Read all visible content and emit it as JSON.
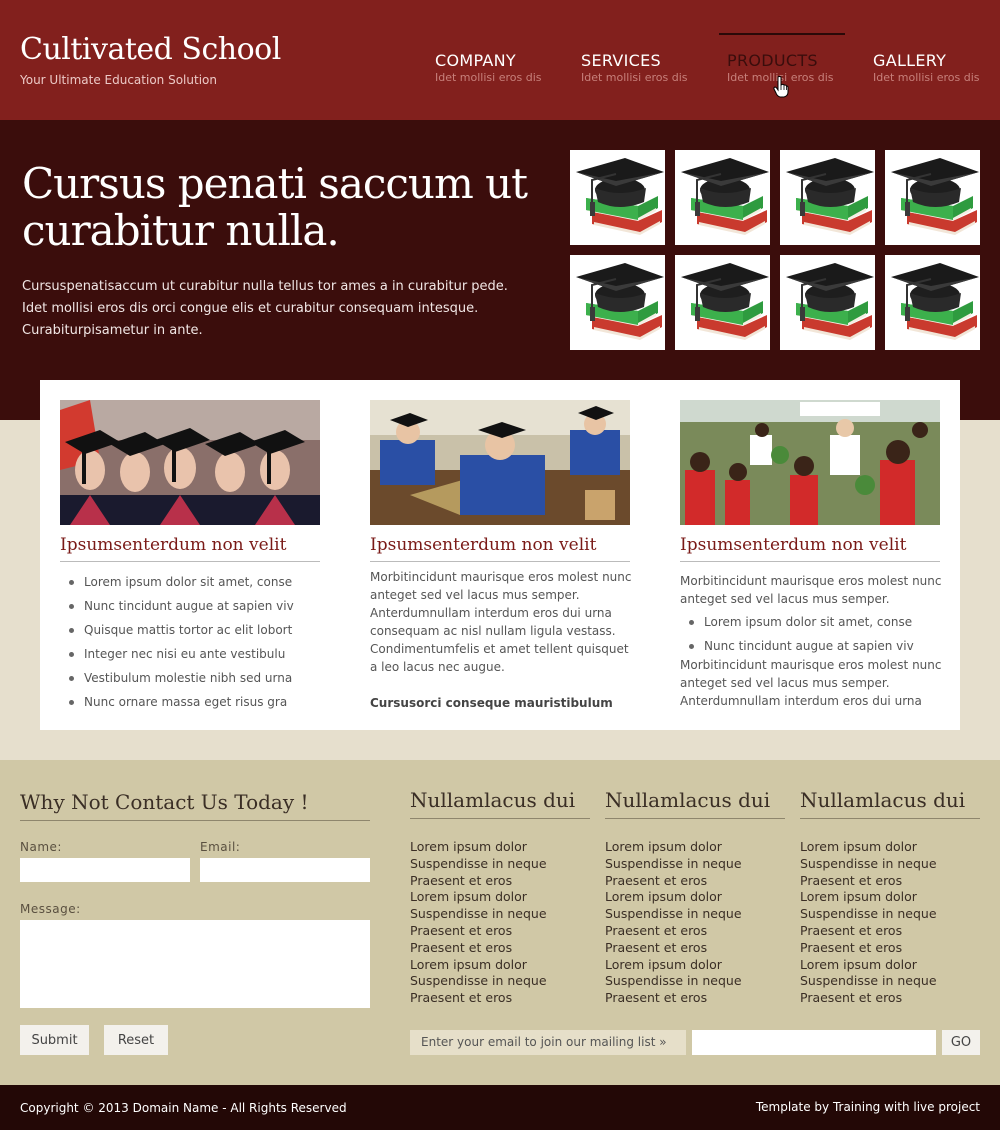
{
  "header": {
    "title": "Cultivated School",
    "tagline": "Your Ultimate Education Solution",
    "nav": [
      {
        "label": "COMPANY",
        "sub": "Idet mollisi eros dis"
      },
      {
        "label": "SERVICES",
        "sub": "Idet mollisi eros dis"
      },
      {
        "label": "PRODUCTS",
        "sub": "Idet mollisi eros dis",
        "active": true
      },
      {
        "label": "GALLERY",
        "sub": "Idet mollisi eros dis"
      }
    ]
  },
  "hero": {
    "title": "Cursus penati saccum ut curabitur nulla.",
    "text": "Cursuspenatisaccum ut curabitur nulla tellus tor ames a in curabitur pede. Idet mollisi eros dis orci congue elis et curabitur consequam intesque. Curabiturpisametur in ante.",
    "thumbnails": [
      "graduation-cap-books-icon",
      "graduation-cap-books-icon",
      "graduation-cap-books-icon",
      "graduation-cap-books-icon",
      "graduation-cap-books-icon",
      "graduation-cap-books-icon",
      "graduation-cap-books-icon",
      "graduation-cap-books-icon"
    ]
  },
  "columns": [
    {
      "title": "Ipsumsenterdum non velit",
      "bullets": [
        "Lorem ipsum dolor sit amet, conse",
        "Nunc tincidunt augue at sapien viv",
        "Quisque mattis tortor ac elit lobort",
        "Integer nec nisi eu ante vestibulu",
        "Vestibulum molestie nibh sed urna",
        "Nunc ornare massa eget risus gra"
      ]
    },
    {
      "title": "Ipsumsenterdum non velit",
      "paragraph": "Morbitincidunt maurisque eros molest nunc anteget sed vel lacus mus semper. Anterdumnullam interdum eros dui urna consequam ac nisl nullam ligula vestass. Condimentumfelis et amet tellent quisquet a leo lacus nec augue.",
      "strong": "Cursusorci conseque mauristibulum"
    },
    {
      "title": "Ipsumsenterdum non velit",
      "paragraph1": "Morbitincidunt maurisque eros molest nunc anteget sed vel lacus mus semper.",
      "bullets": [
        "Lorem ipsum dolor sit amet, conse",
        "Nunc tincidunt augue at sapien viv"
      ],
      "paragraph2": "Morbitincidunt maurisque eros molest nunc anteget sed vel lacus mus semper. Anterdumnullam interdum eros dui urna"
    }
  ],
  "contact": {
    "title": "Why Not Contact Us Today !",
    "name_label": "Name:",
    "email_label": "Email:",
    "message_label": "Message:",
    "submit": "Submit",
    "reset": "Reset"
  },
  "link_columns": [
    {
      "title": "Nullamlacus dui",
      "links": [
        "Lorem ipsum dolor",
        "Suspendisse in neque",
        "Praesent et eros",
        "Lorem ipsum dolor",
        "Suspendisse in neque",
        "Praesent et eros",
        "Praesent et eros",
        "Lorem ipsum dolor",
        "Suspendisse in neque",
        "Praesent et eros"
      ]
    },
    {
      "title": "Nullamlacus dui",
      "links": [
        "Lorem ipsum dolor",
        "Suspendisse in neque",
        "Praesent et eros",
        "Lorem ipsum dolor",
        "Suspendisse in neque",
        "Praesent et eros",
        "Praesent et eros",
        "Lorem ipsum dolor",
        "Suspendisse in neque",
        "Praesent et eros"
      ]
    },
    {
      "title": "Nullamlacus dui",
      "links": [
        "Lorem ipsum dolor",
        "Suspendisse in neque",
        "Praesent et eros",
        "Lorem ipsum dolor",
        "Suspendisse in neque",
        "Praesent et eros",
        "Praesent et eros",
        "Lorem ipsum dolor",
        "Suspendisse in neque",
        "Praesent et eros"
      ]
    }
  ],
  "newsletter": {
    "label": "Enter your email to join our mailing list »",
    "go": "GO"
  },
  "footer": {
    "copyright": "Copyright © 2013 Domain Name - All Rights Reserved",
    "credit": "Template by Training with live project"
  },
  "colors": {
    "header": "#82201d",
    "hero": "#3b0d0c",
    "accent": "#7a1a17",
    "lower": "#d0c8a6",
    "footer": "#230806"
  }
}
